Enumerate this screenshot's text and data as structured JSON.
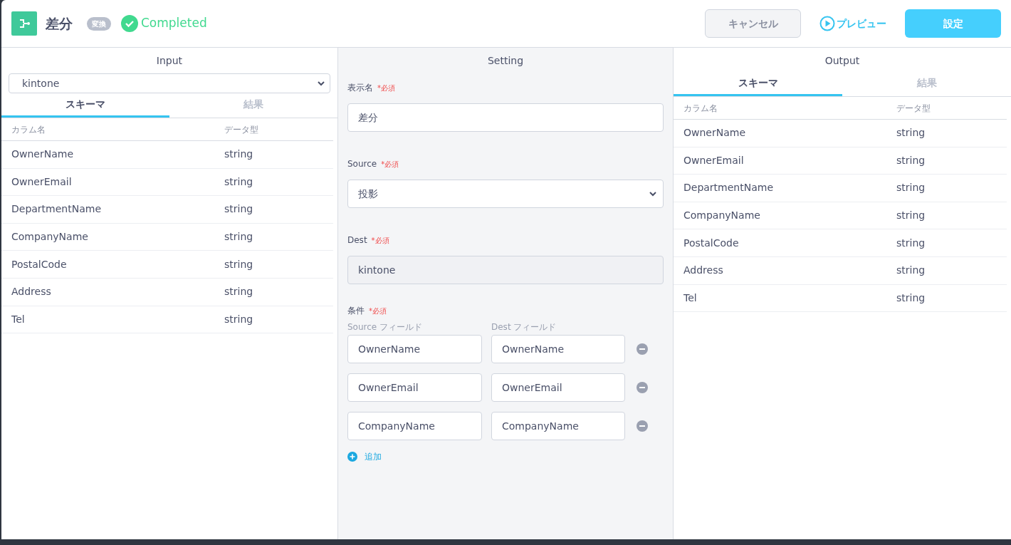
{
  "header": {
    "title": "差分",
    "badge": "変換",
    "status": "Completed",
    "buttons": [
      {
        "kind": "cancel",
        "label": "キャンセル"
      },
      {
        "kind": "preview",
        "label": "プレビュー"
      },
      {
        "kind": "primary",
        "label": "設定"
      }
    ]
  },
  "input": {
    "title": "Input",
    "source": "kintone",
    "tabs": [
      {
        "label": "スキーマ",
        "selected": true
      },
      {
        "label": "結果",
        "selected": false
      }
    ],
    "columns": [
      "カラム名",
      "データ型"
    ],
    "rows": [
      [
        "OwnerName",
        "string"
      ],
      [
        "OwnerEmail",
        "string"
      ],
      [
        "DepartmentName",
        "string"
      ],
      [
        "CompanyName",
        "string"
      ],
      [
        "PostalCode",
        "string"
      ],
      [
        "Address",
        "string"
      ],
      [
        "Tel",
        "string"
      ]
    ]
  },
  "setting": {
    "title": "Setting",
    "fields": [
      {
        "kind": "text",
        "label": "表示名",
        "required": "*必須",
        "value": "差分",
        "disabled": false
      },
      {
        "kind": "select",
        "label": "Source",
        "required": "*必須",
        "value": "投影",
        "disabled": false
      },
      {
        "kind": "text",
        "label": "Dest",
        "required": "*必須",
        "value": "kintone",
        "disabled": true
      }
    ],
    "conditions": {
      "label": "条件",
      "required": "*必須",
      "source_header": "Source フィールド",
      "dest_header": "Dest フィールド",
      "rows": [
        [
          "OwnerName",
          "OwnerName"
        ],
        [
          "OwnerEmail",
          "OwnerEmail"
        ],
        [
          "CompanyName",
          "CompanyName"
        ]
      ],
      "add": "追加"
    }
  },
  "output": {
    "title": "Output",
    "tabs": [
      {
        "label": "スキーマ",
        "selected": true
      },
      {
        "label": "結果",
        "selected": false
      }
    ],
    "columns": [
      "カラム名",
      "データ型"
    ],
    "rows": [
      [
        "OwnerName",
        "string"
      ],
      [
        "OwnerEmail",
        "string"
      ],
      [
        "DepartmentName",
        "string"
      ],
      [
        "CompanyName",
        "string"
      ],
      [
        "PostalCode",
        "string"
      ],
      [
        "Address",
        "string"
      ],
      [
        "Tel",
        "string"
      ]
    ]
  }
}
